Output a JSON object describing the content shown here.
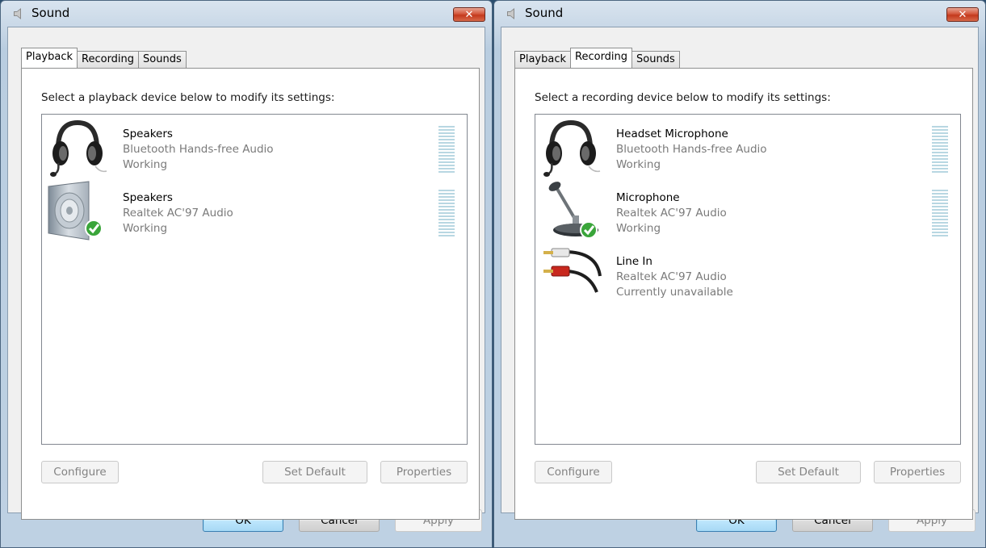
{
  "windows": [
    {
      "title": "Sound",
      "tabs": [
        "Playback",
        "Recording",
        "Sounds"
      ],
      "active_tab": 0,
      "instruction": "Select a playback device below to modify its settings:",
      "devices": [
        {
          "name": "Speakers",
          "driver": "Bluetooth Hands-free Audio",
          "status": "Working",
          "icon": "headset-icon",
          "is_default": false
        },
        {
          "name": "Speakers",
          "driver": "Realtek AC'97 Audio",
          "status": "Working",
          "icon": "speaker-icon",
          "is_default": true
        }
      ],
      "buttons": {
        "configure": "Configure",
        "set_default": "Set Default",
        "properties": "Properties"
      },
      "footer": {
        "ok": "OK",
        "cancel": "Cancel",
        "apply": "Apply"
      }
    },
    {
      "title": "Sound",
      "tabs": [
        "Playback",
        "Recording",
        "Sounds"
      ],
      "active_tab": 1,
      "instruction": "Select a recording device below to modify its settings:",
      "devices": [
        {
          "name": "Headset Microphone",
          "driver": "Bluetooth Hands-free Audio",
          "status": "Working",
          "icon": "headset-icon",
          "is_default": false
        },
        {
          "name": "Microphone",
          "driver": "Realtek AC'97 Audio",
          "status": "Working",
          "icon": "microphone-icon",
          "is_default": true
        },
        {
          "name": "Line In",
          "driver": "Realtek AC'97 Audio",
          "status": "Currently unavailable",
          "icon": "rca-cable-icon",
          "is_default": false
        }
      ],
      "buttons": {
        "configure": "Configure",
        "set_default": "Set Default",
        "properties": "Properties"
      },
      "footer": {
        "ok": "OK",
        "cancel": "Cancel",
        "apply": "Apply"
      }
    }
  ],
  "colors": {
    "accent": "#3c7fb1",
    "close_button": "#c3391d",
    "meter": "#b8d7e2",
    "default_check": "#3aa53a"
  }
}
